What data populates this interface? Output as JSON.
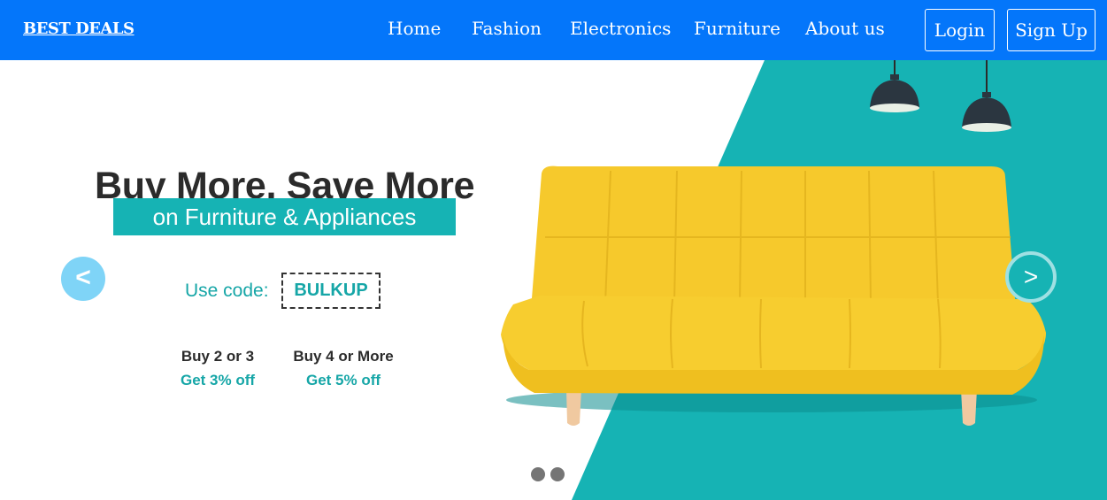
{
  "nav": {
    "brand": "BEST DEALS",
    "items": [
      "Home",
      "Fashion",
      "Electronics",
      "Furniture",
      "About us"
    ],
    "login": "Login",
    "signup": "Sign Up"
  },
  "banner": {
    "headline": "Buy More, Save More",
    "subhead": "on Furniture & Appliances",
    "code_label": "Use code:",
    "code": "BULKUP",
    "offers": [
      {
        "title": "Buy 2 or 3",
        "deal": "Get 3% off"
      },
      {
        "title": "Buy 4 or More",
        "deal": "Get 5% off"
      }
    ],
    "prev": "<",
    "next": ">"
  },
  "colors": {
    "navbar": "#0476fa",
    "accent": "#16b3b4",
    "sofa": "#f7cd2f"
  },
  "icons": [
    "pendant-lamp-icon",
    "sofa-image"
  ]
}
